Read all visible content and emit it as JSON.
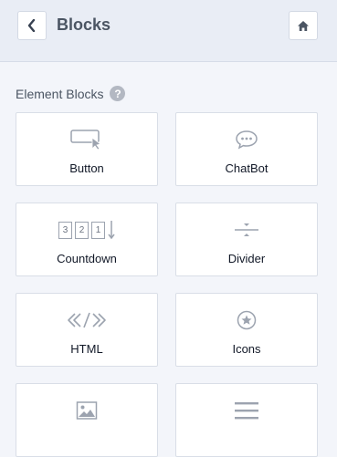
{
  "header": {
    "title": "Blocks",
    "back_icon": "chevron-left-icon",
    "home_icon": "home-icon"
  },
  "section": {
    "title": "Element Blocks",
    "help_glyph": "?"
  },
  "blocks": [
    {
      "label": "Button",
      "icon": "button-cursor-icon"
    },
    {
      "label": "ChatBot",
      "icon": "chat-bubble-icon"
    },
    {
      "label": "Countdown",
      "icon": "countdown-icon",
      "digits": [
        "3",
        "2",
        "1"
      ]
    },
    {
      "label": "Divider",
      "icon": "divider-icon"
    },
    {
      "label": "HTML",
      "icon": "code-icon"
    },
    {
      "label": "Icons",
      "icon": "star-circle-icon"
    },
    {
      "label": "",
      "icon": "image-icon"
    },
    {
      "label": "",
      "icon": "menu-lines-icon"
    }
  ],
  "colors": {
    "background": "#f3f5fa",
    "header": "#e9edf5",
    "icon": "#9ca3af"
  }
}
